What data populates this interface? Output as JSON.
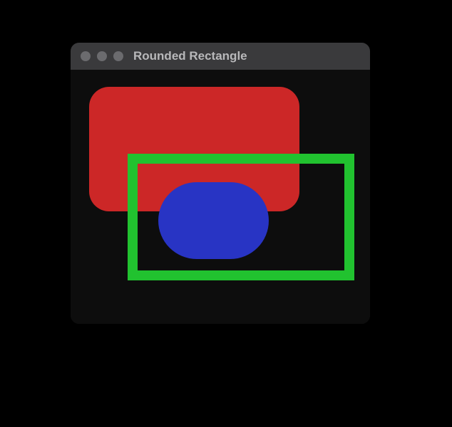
{
  "window": {
    "title": "Rounded Rectangle"
  },
  "shapes": {
    "red_rect": {
      "name": "red-rounded-rectangle",
      "color": "#cc2727"
    },
    "blue_capsule": {
      "name": "blue-capsule",
      "color": "#2834c4"
    },
    "green_outline": {
      "name": "green-outline-rectangle",
      "color": "#21c22f"
    }
  }
}
